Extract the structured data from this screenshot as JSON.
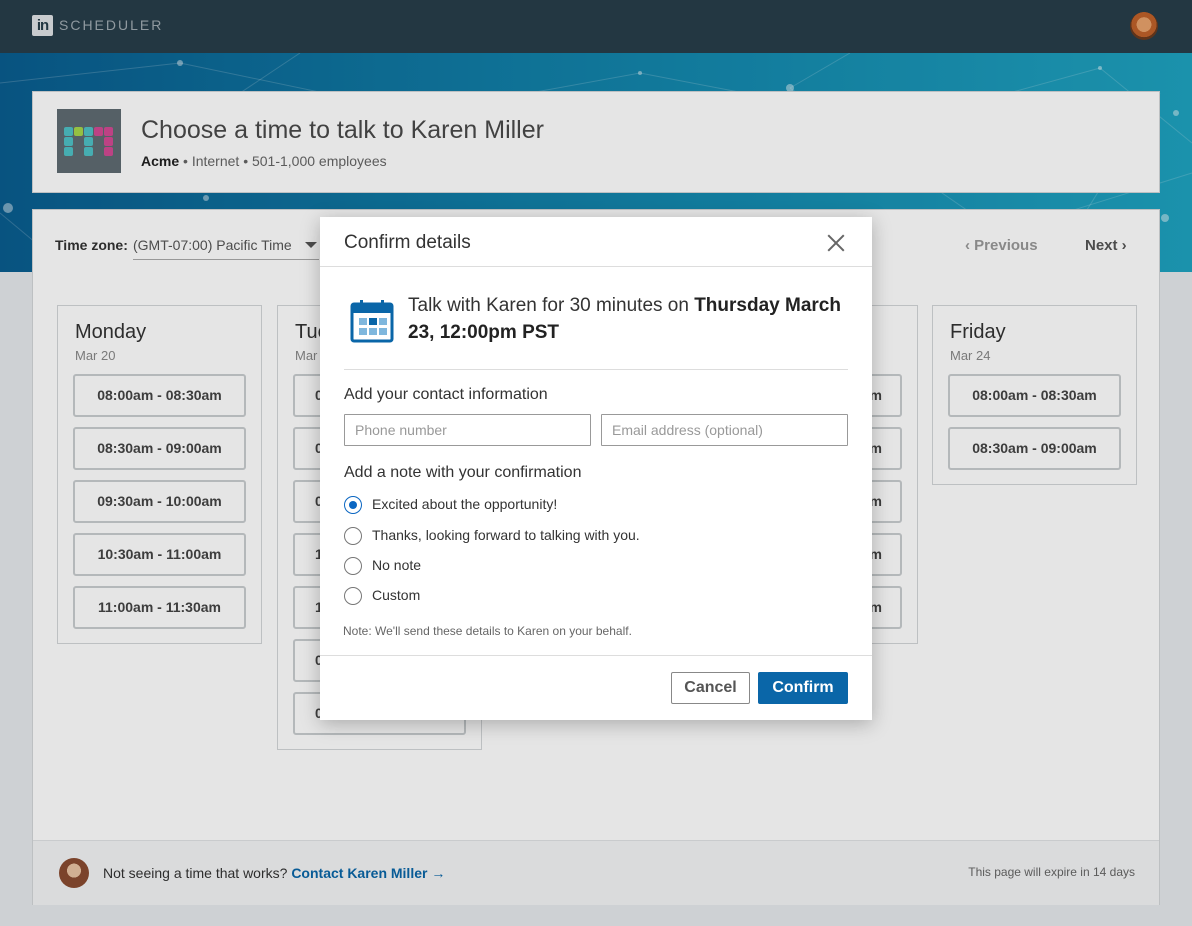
{
  "topbar": {
    "logo_text": "in",
    "brand": "SCHEDULER"
  },
  "header": {
    "title": "Choose a time to talk to Karen Miller",
    "company": "Acme",
    "details": "• Internet • 501-1,000 employees"
  },
  "scheduler": {
    "timezone_label": "Time zone:",
    "timezone_value": "(GMT-07:00) Pacific Time",
    "previous_label": "Previous",
    "next_label": "Next",
    "days": [
      {
        "name": "Monday",
        "date": "Mar 20",
        "slots": [
          "08:00am - 08:30am",
          "08:30am - 09:00am",
          "09:30am - 10:00am",
          "10:30am - 11:00am",
          "11:00am - 11:30am"
        ]
      },
      {
        "name": "Friday",
        "date": "Mar 24",
        "slots": [
          "08:00am - 08:30am",
          "08:30am - 09:00am"
        ]
      }
    ],
    "partial_day_heading": "Tue",
    "partial_day_date": "Mar",
    "partial_slot_chars": [
      "0",
      "0",
      "0",
      "1",
      "1",
      "0",
      "0"
    ],
    "partial_right_slot_chars": [
      "m",
      "m",
      "m",
      "m",
      "m"
    ]
  },
  "footer": {
    "message": "Not seeing a time that works?",
    "contact_link": "Contact Karen Miller",
    "arrow": "→",
    "expire_text": "This page will expire in 14 days"
  },
  "modal": {
    "title": "Confirm details",
    "summary_prefix": "Talk with Karen for 30 minutes on ",
    "summary_bold": "Thursday March 23, 12:00pm PST",
    "contact_heading": "Add your contact information",
    "phone_placeholder": "Phone number",
    "email_placeholder": "Email address (optional)",
    "note_heading": "Add a note with your confirmation",
    "options": [
      {
        "label": "Excited about the opportunity!",
        "selected": true
      },
      {
        "label": "Thanks, looking forward to talking with you.",
        "selected": false
      },
      {
        "label": "No note",
        "selected": false
      },
      {
        "label": "Custom",
        "selected": false
      }
    ],
    "note_text": "Note: We'll send these details to Karen on your behalf.",
    "cancel_label": "Cancel",
    "confirm_label": "Confirm"
  },
  "colors": {
    "topbar": "#283e4a",
    "primary": "#0a66a8",
    "radio_selected": "#0a66c2"
  }
}
